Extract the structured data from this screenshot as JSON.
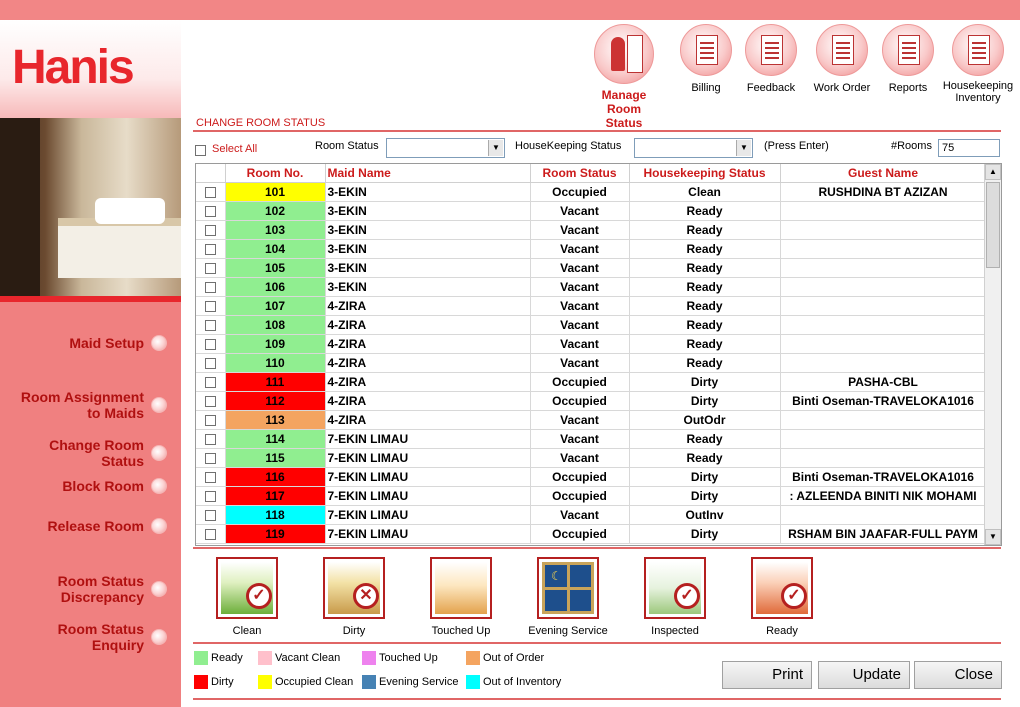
{
  "app": {
    "logo": "Hanis"
  },
  "sidebar": {
    "items": [
      {
        "label": "Maid Setup"
      },
      {
        "label": "Room Assignment\nto Maids"
      },
      {
        "label": "Change Room\nStatus"
      },
      {
        "label": "Block Room"
      },
      {
        "label": "Release Room"
      },
      {
        "label": "Room Status\nDiscrepancy"
      },
      {
        "label": "Room Status\nEnquiry"
      }
    ]
  },
  "topnav": [
    {
      "label": "Manage Room\nStatus",
      "icon": "manage-room-icon"
    },
    {
      "label": "Billing",
      "icon": "invoice-icon"
    },
    {
      "label": "Feedback",
      "icon": "feedback-icon"
    },
    {
      "label": "Work Order",
      "icon": "work-order-icon"
    },
    {
      "label": "Reports",
      "icon": "report-icon"
    },
    {
      "label": "Housekeeping\nInventory",
      "icon": "inventory-icon"
    }
  ],
  "section_title": "CHANGE ROOM STATUS",
  "filters": {
    "select_all": "Select All",
    "room_status_label": "Room Status",
    "room_status_value": "",
    "hk_status_label": "HouseKeeping Status",
    "hk_status_value": "",
    "press_enter": "(Press Enter)",
    "rooms_label": "#Rooms",
    "rooms_value": "75"
  },
  "grid": {
    "columns": [
      "Room No.",
      "Maid Name",
      "Room Status",
      "Housekeeping Status",
      "Guest Name"
    ],
    "rows": [
      {
        "room": "101",
        "maid": "3-EKIN",
        "status": "Occupied",
        "hk": "Clean",
        "guest": "RUSHDINA BT AZIZAN",
        "color": "#ffff00"
      },
      {
        "room": "102",
        "maid": "3-EKIN",
        "status": "Vacant",
        "hk": "Ready",
        "guest": "",
        "color": "#90ee90"
      },
      {
        "room": "103",
        "maid": "3-EKIN",
        "status": "Vacant",
        "hk": "Ready",
        "guest": "",
        "color": "#90ee90"
      },
      {
        "room": "104",
        "maid": "3-EKIN",
        "status": "Vacant",
        "hk": "Ready",
        "guest": "",
        "color": "#90ee90"
      },
      {
        "room": "105",
        "maid": "3-EKIN",
        "status": "Vacant",
        "hk": "Ready",
        "guest": "",
        "color": "#90ee90"
      },
      {
        "room": "106",
        "maid": "3-EKIN",
        "status": "Vacant",
        "hk": "Ready",
        "guest": "",
        "color": "#90ee90"
      },
      {
        "room": "107",
        "maid": "4-ZIRA",
        "status": "Vacant",
        "hk": "Ready",
        "guest": "",
        "color": "#90ee90"
      },
      {
        "room": "108",
        "maid": "4-ZIRA",
        "status": "Vacant",
        "hk": "Ready",
        "guest": "",
        "color": "#90ee90"
      },
      {
        "room": "109",
        "maid": "4-ZIRA",
        "status": "Vacant",
        "hk": "Ready",
        "guest": "",
        "color": "#90ee90"
      },
      {
        "room": "110",
        "maid": "4-ZIRA",
        "status": "Vacant",
        "hk": "Ready",
        "guest": "",
        "color": "#90ee90"
      },
      {
        "room": "111",
        "maid": "4-ZIRA",
        "status": "Occupied",
        "hk": "Dirty",
        "guest": "PASHA-CBL",
        "color": "#ff0000"
      },
      {
        "room": "112",
        "maid": "4-ZIRA",
        "status": "Occupied",
        "hk": "Dirty",
        "guest": "Binti Oseman-TRAVELOKA1016",
        "color": "#ff0000"
      },
      {
        "room": "113",
        "maid": "4-ZIRA",
        "status": "Vacant",
        "hk": "OutOdr",
        "guest": "",
        "color": "#f4a460"
      },
      {
        "room": "114",
        "maid": "7-EKIN LIMAU",
        "status": "Vacant",
        "hk": "Ready",
        "guest": "",
        "color": "#90ee90"
      },
      {
        "room": "115",
        "maid": "7-EKIN LIMAU",
        "status": "Vacant",
        "hk": "Ready",
        "guest": "",
        "color": "#90ee90"
      },
      {
        "room": "116",
        "maid": "7-EKIN LIMAU",
        "status": "Occupied",
        "hk": "Dirty",
        "guest": "Binti Oseman-TRAVELOKA1016",
        "color": "#ff0000"
      },
      {
        "room": "117",
        "maid": "7-EKIN LIMAU",
        "status": "Occupied",
        "hk": "Dirty",
        "guest": ": AZLEENDA BINITI NIK MOHAMI",
        "color": "#ff0000"
      },
      {
        "room": "118",
        "maid": "7-EKIN LIMAU",
        "status": "Vacant",
        "hk": "OutInv",
        "guest": "",
        "color": "#00ffff"
      },
      {
        "room": "119",
        "maid": "7-EKIN LIMAU",
        "status": "Occupied",
        "hk": "Dirty",
        "guest": "RSHAM BIN JAAFAR-FULL PAYM",
        "color": "#ff0000"
      }
    ]
  },
  "status_actions": [
    {
      "label": "Clean",
      "icon": "clean-room-icon"
    },
    {
      "label": "Dirty",
      "icon": "dirty-room-icon"
    },
    {
      "label": "Touched Up",
      "icon": "touched-up-icon"
    },
    {
      "label": "Evening Service",
      "icon": "evening-service-icon"
    },
    {
      "label": "Inspected",
      "icon": "inspected-icon"
    },
    {
      "label": "Ready",
      "icon": "ready-icon"
    }
  ],
  "legend": [
    {
      "label": "Ready",
      "color": "#90ee90"
    },
    {
      "label": "Vacant Clean",
      "color": "#ffc0cb"
    },
    {
      "label": "Touched Up",
      "color": "#ee82ee"
    },
    {
      "label": "Out of Order",
      "color": "#f4a460"
    },
    {
      "label": "Dirty",
      "color": "#ff0000"
    },
    {
      "label": "Occupied Clean",
      "color": "#ffff00"
    },
    {
      "label": "Evening Service",
      "color": "#4682b4"
    },
    {
      "label": "Out of Inventory",
      "color": "#00ffff"
    }
  ],
  "buttons": {
    "print": "Print",
    "update": "Update",
    "close": "Close"
  }
}
